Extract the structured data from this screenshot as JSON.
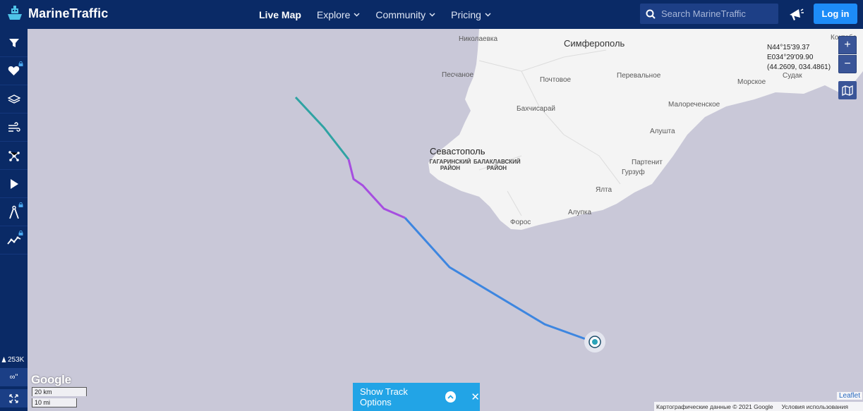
{
  "header": {
    "brand": "MarineTraffic",
    "nav": [
      {
        "label": "Live Map",
        "active": true,
        "dropdown": false
      },
      {
        "label": "Explore",
        "active": false,
        "dropdown": true
      },
      {
        "label": "Community",
        "active": false,
        "dropdown": true
      },
      {
        "label": "Pricing",
        "active": false,
        "dropdown": true
      }
    ],
    "search_placeholder": "Search MarineTraffic",
    "login_label": "Log in"
  },
  "sidebar": {
    "buttons": [
      {
        "icon": "filter-icon",
        "locked": false
      },
      {
        "icon": "heart-icon",
        "locked": true
      },
      {
        "icon": "layers-icon",
        "locked": false
      },
      {
        "icon": "wind-icon",
        "locked": false
      },
      {
        "icon": "network-icon",
        "locked": false
      },
      {
        "icon": "play-icon",
        "locked": false
      },
      {
        "icon": "compass-icon",
        "locked": true
      },
      {
        "icon": "chart-line-icon",
        "locked": true
      }
    ],
    "vessel_count": "253K",
    "infinity_label": "∞\""
  },
  "map": {
    "places": {
      "nikolaevka": "Николаевка",
      "simferopol": "Симферополь",
      "koktebel": "Коктебе",
      "peschanoe": "Песчаное",
      "pochtovoe": "Почтовое",
      "perevalnoe": "Перевальное",
      "morskoe": "Морское",
      "sudak": "Судак",
      "bakhchisaray": "Бахчисарай",
      "malorechenskoe": "Малореченское",
      "sevastopol": "Севастополь",
      "gagarinsky": "ГАГАРИНСКИЙ РАЙОН",
      "balaklavsky": "БАЛАКЛАВСКИЙ РАЙОН",
      "alushta": "Алушта",
      "partenit": "Партенит",
      "gurzuf": "Гурзуф",
      "yalta": "Ялта",
      "alupka": "Алупка",
      "foros": "Форос"
    },
    "coords": {
      "lat": "N44°15'39.37",
      "lon": "E034°29'09.90",
      "decimal": "(44.2609, 034.4861)"
    },
    "zoom_in": "+",
    "zoom_out": "−",
    "google_logo": "Google",
    "scale_km": "20 km",
    "scale_mi": "10 mi",
    "track_options_label": "Show Track Options",
    "leaflet": "Leaflet",
    "attribution": "Картографические данные © 2021 Google",
    "terms": "Условия использования",
    "colors": {
      "header": "#0a2a66",
      "sea": "#c9c8d8",
      "land": "#f4f4f4",
      "track_teal": "#2fa3a3",
      "track_purple": "#a64ee0",
      "track_blue": "#3d86e0",
      "track_button": "#22a4e6",
      "login": "#1d8cf8"
    }
  }
}
